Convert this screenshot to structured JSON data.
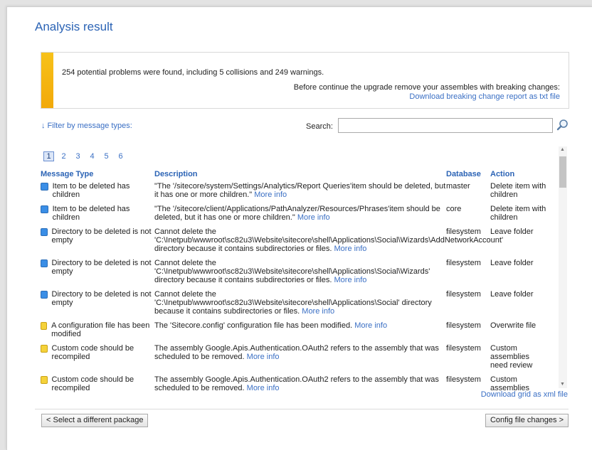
{
  "page": {
    "title": "Analysis result"
  },
  "notice": {
    "summary": "254 potential problems were found, including 5 collisions and 249 warnings.",
    "advice": "Before continue the upgrade remove your assembles with breaking changes:",
    "download_link": "Download breaking change report as txt file",
    "accent_color": "#f2b81a"
  },
  "filter": {
    "label": "↓ Filter by message types:"
  },
  "search": {
    "label": "Search:",
    "value": "",
    "icon": "magnifier-icon"
  },
  "pager": {
    "pages": [
      "1",
      "2",
      "3",
      "4",
      "5",
      "6"
    ],
    "current": "1"
  },
  "grid": {
    "columns": [
      "Message Type",
      "Description",
      "Database",
      "Action"
    ],
    "rows": [
      {
        "kind": "info",
        "type": "Item to be deleted has children",
        "desc": "\"The '/sitecore/system/Settings/Analytics/Report Queries'item should be deleted, but it has one or more children.\"",
        "more": "More info",
        "db": "master",
        "action": "Delete item with children"
      },
      {
        "kind": "info",
        "type": "Item to be deleted has children",
        "desc": "\"The '/sitecore/client/Applications/PathAnalyzer/Resources/Phrases'item should be deleted, but it has one or more children.\"",
        "more": "More info",
        "db": "core",
        "action": "Delete item with children"
      },
      {
        "kind": "info",
        "type": "Directory to be deleted is not empty",
        "desc": "Cannot delete the 'C:\\Inetpub\\wwwroot\\sc82u3\\Website\\sitecore\\shell\\Applications\\Social\\Wizards\\AddNetworkAccount' directory because it contains subdirectories or files.",
        "more": "More info",
        "db": "filesystem",
        "action": "Leave folder"
      },
      {
        "kind": "info",
        "type": "Directory to be deleted is not empty",
        "desc": "Cannot delete the 'C:\\Inetpub\\wwwroot\\sc82u3\\Website\\sitecore\\shell\\Applications\\Social\\Wizards' directory because it contains subdirectories or files.",
        "more": "More info",
        "db": "filesystem",
        "action": "Leave folder"
      },
      {
        "kind": "info",
        "type": "Directory to be deleted is not empty",
        "desc": "Cannot delete the 'C:\\Inetpub\\wwwroot\\sc82u3\\Website\\sitecore\\shell\\Applications\\Social' directory because it contains subdirectories or files.",
        "more": "More info",
        "db": "filesystem",
        "action": "Leave folder"
      },
      {
        "kind": "warn",
        "type": "A configuration file has been modified",
        "desc": "The 'Sitecore.config' configuration file has been modified.",
        "more": "More info",
        "db": "filesystem",
        "action": "Overwrite file"
      },
      {
        "kind": "warn",
        "type": "Custom code should be recompiled",
        "desc": "The assembly Google.Apis.Authentication.OAuth2 refers to the assembly that was scheduled to be removed.",
        "more": "More info",
        "db": "filesystem",
        "action": "Custom assemblies need review"
      },
      {
        "kind": "warn",
        "type": "Custom code should be recompiled",
        "desc": "The assembly Google.Apis.Authentication.OAuth2 refers to the assembly that was scheduled to be removed.",
        "more": "More info",
        "db": "filesystem",
        "action": "Custom assemblies"
      }
    ]
  },
  "xml_link": "Download grid as xml file",
  "buttons": {
    "back": "< Select a different package",
    "next": "Config file changes >"
  }
}
